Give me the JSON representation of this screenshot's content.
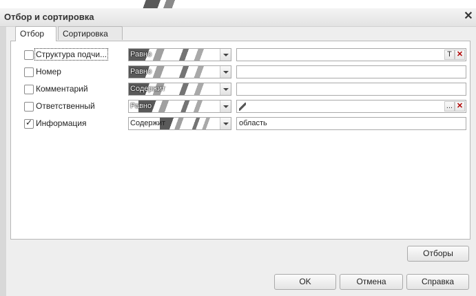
{
  "window": {
    "title": "Отбор и сортировка",
    "close_glyph": "✕"
  },
  "tabs": [
    {
      "label": "Отбор",
      "active": true
    },
    {
      "label": "Сортировка",
      "active": false
    }
  ],
  "filters": [
    {
      "label": "Структура подчи...",
      "checked": false,
      "condition": "Равно",
      "value": "",
      "buttons": [
        "T",
        "✕"
      ]
    },
    {
      "label": "Номер",
      "checked": false,
      "condition": "Равно",
      "value": "",
      "buttons": []
    },
    {
      "label": "Комментарий",
      "checked": false,
      "condition": "Содержит",
      "value": "",
      "buttons": []
    },
    {
      "label": "Ответственный",
      "checked": false,
      "condition": "Равно",
      "value": "",
      "buttons": [
        "...",
        "✕"
      ]
    },
    {
      "label": "Информация",
      "checked": true,
      "condition": "Содержит",
      "value": "область",
      "buttons": []
    }
  ],
  "buttons": {
    "filters": "Отборы",
    "ok": "OK",
    "cancel": "Отмена",
    "help": "Справка"
  }
}
